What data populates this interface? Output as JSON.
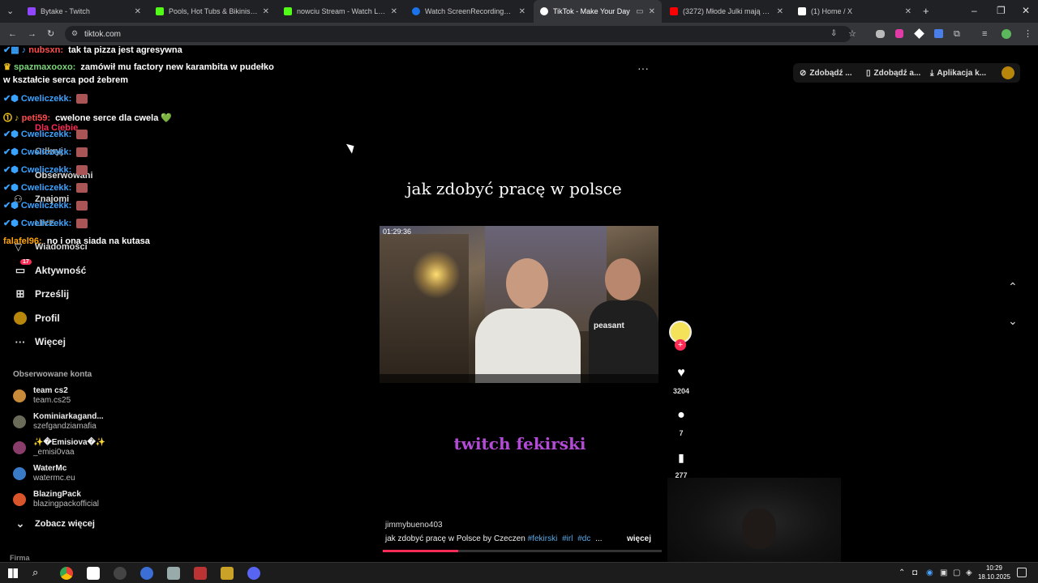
{
  "browser": {
    "tabs": [
      {
        "title": "Bytake - Twitch",
        "color": "#9146ff"
      },
      {
        "title": "Pools, Hot Tubs & Bikinis Stream",
        "color": "#53fc18"
      },
      {
        "title": "nowciu Stream - Watch Live on",
        "color": "#53fc18"
      },
      {
        "title": "Watch ScreenRecording_10-15",
        "color": "#1a73e8"
      },
      {
        "title": "TikTok - Make Your Day",
        "color": "#ffffff"
      },
      {
        "title": "(3272) Młode Julki mają dość!",
        "color": "#ff0000"
      },
      {
        "title": "(1) Home / X",
        "color": "#ffffff"
      }
    ],
    "new_tab": "+",
    "url": "tiktok.com"
  },
  "chat": [
    {
      "user": "nubsxn:",
      "user_color": "#ff4d4d",
      "text": "tak ta pizza jest agresywna"
    },
    {
      "user": "spazmaxooxo:",
      "user_color": "#7cd67c",
      "text": "zamówił mu factory new karambita w pudełko"
    },
    {
      "user": "",
      "user_color": "#ffffff",
      "text": "w kształcie serca pod żebrem"
    },
    {
      "user": "Cweliczekk:",
      "user_color": "#3aa3ff",
      "text": ""
    },
    {
      "user": "peti59:",
      "user_color": "#ff4d4d",
      "text": "cwelone serce dla cwela 💚"
    },
    {
      "user": "Cweliczekk:",
      "user_color": "#3aa3ff",
      "text": ""
    },
    {
      "user": "Cweliczekk:",
      "user_color": "#3aa3ff",
      "text": ""
    },
    {
      "user": "Cweliczekk:",
      "user_color": "#3aa3ff",
      "text": ""
    },
    {
      "user": "Cweliczekk:",
      "user_color": "#3aa3ff",
      "text": ""
    },
    {
      "user": "Cweliczekk:",
      "user_color": "#3aa3ff",
      "text": ""
    },
    {
      "user": "Cweliczekk:",
      "user_color": "#3aa3ff",
      "text": ""
    },
    {
      "user": "falafel96:",
      "user_color": "#ffa500",
      "text": "no i ona siada na kutasa"
    }
  ],
  "sidebar": {
    "ghost_items": [
      "Dla Ciebie",
      "Odkryj",
      "Obserwowani",
      "Znajomi",
      "LIVE",
      "Wiadomości"
    ],
    "items": [
      {
        "label": "Aktywność",
        "badge": "17",
        "icon": "inbox-icon"
      },
      {
        "label": "Prześlij",
        "icon": "upload-icon"
      },
      {
        "label": "Profil",
        "icon": "profile-icon"
      },
      {
        "label": "Więcej",
        "icon": "more-icon"
      }
    ],
    "followed_title": "Obserwowane konta",
    "accounts": [
      {
        "name": "team cs2",
        "handle": "team.cs25",
        "color": "#c88b3a"
      },
      {
        "name": "Kominiarkagand...",
        "handle": "szefgandziamafia",
        "color": "#6b6b5a"
      },
      {
        "name": "✨�Emisiova�✨",
        "handle": "_emisi0vaa",
        "color": "#8a3d6b"
      },
      {
        "name": "WaterMc",
        "handle": "watermc.eu",
        "color": "#3a7bc8"
      },
      {
        "name": "BlazingPack",
        "handle": "blazingpackofficial",
        "color": "#d9552b"
      }
    ],
    "see_more": "Zobacz więcej",
    "company": "Firma"
  },
  "top_right": {
    "btn1": "Zdobądź ...",
    "btn2": "Zdobądź a...",
    "btn3": "Aplikacja k..."
  },
  "video": {
    "caption_top": "jak zdobyć pracę w polsce",
    "timestamp": "01:29:36",
    "shirt_text": "peasant",
    "caption_bottom": "twitch fekirski",
    "author": "jimmybueno403",
    "description": "jak zdobyć pracę w Polsce by Czeczen",
    "hashtags": [
      "#fekirski",
      "#irl",
      "#dc"
    ],
    "ellipsis": "...",
    "more": "więcej",
    "progress": 0.27
  },
  "actions": {
    "likes": "3204",
    "comments": "7",
    "saves": "277"
  },
  "taskbar": {
    "time": "10:29",
    "date": "18.10.2025"
  }
}
